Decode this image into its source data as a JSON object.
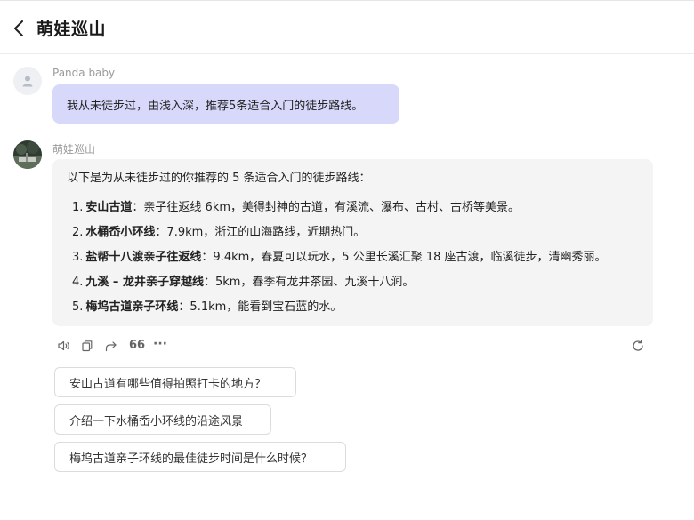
{
  "header": {
    "title": "萌娃巡山"
  },
  "user_message": {
    "sender": "Panda baby",
    "text": "我从未徒步过，由浅入深，推荐5条适合入门的徒步路线。"
  },
  "bot_message": {
    "sender": "萌娃巡山",
    "intro": "以下是为从未徒步过的你推荐的 5 条适合入门的徒步路线：",
    "routes": [
      {
        "num": "1.",
        "name": "安山古道",
        "desc": "：亲子往返线 6km，美得封神的古道，有溪流、瀑布、古村、古桥等美景。"
      },
      {
        "num": "2.",
        "name": "水桶岙小环线",
        "desc": "：7.9km，浙江的山海路线，近期热门。"
      },
      {
        "num": "3.",
        "name": "盐帮十八渡亲子往返线",
        "desc": "：9.4km，春夏可以玩水，5 公里长溪汇聚 18 座古渡，临溪徒步，清幽秀丽。"
      },
      {
        "num": "4.",
        "name": "九溪 – 龙井亲子穿越线",
        "desc": "：5km，春季有龙井茶园、九溪十八涧。"
      },
      {
        "num": "5.",
        "name": "梅坞古道亲子环线",
        "desc": "：5.1km，能看到宝石蓝的水。"
      }
    ]
  },
  "actions": {
    "icons": [
      "speaker-icon",
      "copy-icon",
      "share-icon",
      "quote-icon",
      "more-icon",
      "regenerate-icon"
    ],
    "quote_glyph": "66",
    "more_glyph": "···"
  },
  "suggestions": [
    "安山古道有哪些值得拍照打卡的地方？",
    "介绍一下水桶岙小环线的沿途风景",
    "梅坞古道亲子环线的最佳徒步时间是什么时候？"
  ],
  "colors": {
    "user_bubble": "#d8d8fb",
    "bot_bubble": "#f4f4f5",
    "muted_text": "#9a9a9a"
  }
}
